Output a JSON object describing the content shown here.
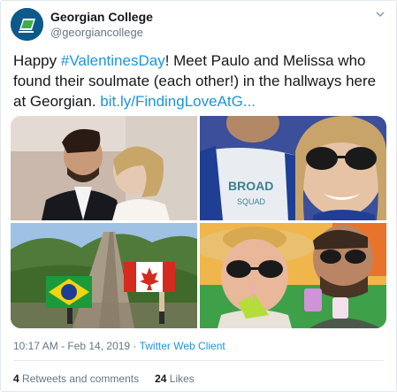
{
  "author": {
    "name": "Georgian College",
    "handle": "@georgiancollege",
    "avatar_icon": "georgian-college-logo"
  },
  "tweet": {
    "text_before": "Happy ",
    "hashtag": "#ValentinesDay",
    "text_after": "! Meet Paulo and Melissa who found their soulmate (each other!) in the hallways here at Georgian. ",
    "link": "bit.ly/FindingLoveAtG..."
  },
  "photos": [
    {
      "icon": "photo-couple-kiss"
    },
    {
      "icon": "photo-couple-selfie"
    },
    {
      "icon": "photo-great-wall-flags"
    },
    {
      "icon": "photo-couple-drinks"
    }
  ],
  "meta": {
    "time": "10:17 AM",
    "date": "Feb 14, 2019",
    "separator": "·",
    "client": "Twitter Web Client"
  },
  "stats": {
    "retweets_count": "4",
    "retweets_label": "Retweets and comments",
    "likes_count": "24",
    "likes_label": "Likes"
  },
  "colors": {
    "link": "#1b95e0",
    "secondary_text": "#657786",
    "avatar_bg": "#0b5a8a",
    "logo_green": "#3fae49"
  }
}
